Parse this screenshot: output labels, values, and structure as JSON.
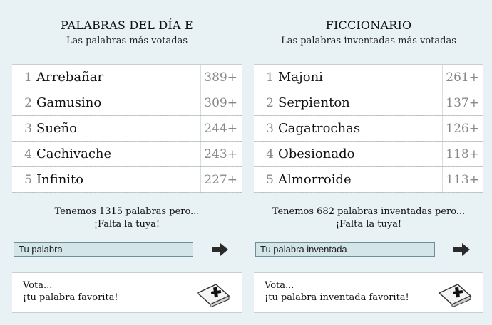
{
  "left": {
    "title": "PALABRAS DEL DÍA E",
    "subtitle": "Las palabras más votadas",
    "items": [
      {
        "rank": "1",
        "word": "Arrebañar",
        "votes": "389+"
      },
      {
        "rank": "2",
        "word": "Gamusino",
        "votes": "309+"
      },
      {
        "rank": "3",
        "word": "Sueño",
        "votes": "244+"
      },
      {
        "rank": "4",
        "word": "Cachivache",
        "votes": "243+"
      },
      {
        "rank": "5",
        "word": "Infinito",
        "votes": "227+"
      }
    ],
    "count_line1": "Tenemos 1315 palabras pero...",
    "count_line2": "¡Falta la tuya!",
    "input_placeholder": "Tu palabra",
    "vote_line1": "Vota...",
    "vote_line2": "¡tu palabra favorita!",
    "submit_icon": "arrow-right-icon",
    "vote_icon": "ballot-box-icon"
  },
  "right": {
    "title": "FICCIONARIO",
    "subtitle": "Las palabras inventadas más votadas",
    "items": [
      {
        "rank": "1",
        "word": "Majoni",
        "votes": "261+"
      },
      {
        "rank": "2",
        "word": "Serpienton",
        "votes": "137+"
      },
      {
        "rank": "3",
        "word": "Cagatrochas",
        "votes": "126+"
      },
      {
        "rank": "4",
        "word": "Obesionado",
        "votes": "118+"
      },
      {
        "rank": "5",
        "word": "Almorroide",
        "votes": "113+"
      }
    ],
    "count_line1": "Tenemos 682 palabras inventadas pero...",
    "count_line2": "¡Falta la tuya!",
    "input_placeholder": "Tu palabra inventada",
    "vote_line1": "Vota...",
    "vote_line2": "¡tu palabra inventada favorita!",
    "submit_icon": "arrow-right-icon",
    "vote_icon": "ballot-box-icon"
  }
}
